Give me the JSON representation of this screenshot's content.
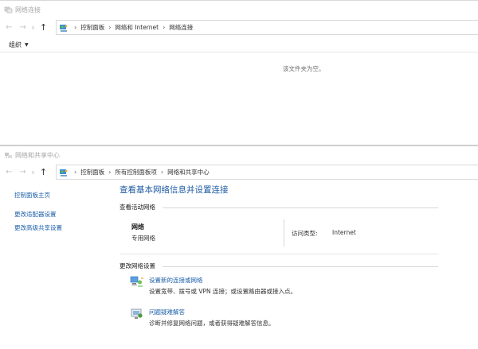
{
  "network_connections": {
    "title": "网络连接",
    "breadcrumb": [
      "控制面板",
      "网络和 Internet",
      "网络连接"
    ],
    "organize_label": "组织",
    "empty_message": "该文件夹为空。"
  },
  "network_center": {
    "title": "网络和共享中心",
    "breadcrumb": [
      "控制面板",
      "所有控制面板项",
      "网络和共享中心"
    ],
    "left_nav": [
      "控制面板主页",
      "更改适配器设置",
      "更改高级共享设置"
    ],
    "heading": "查看基本网络信息并设置连接",
    "active_section": "查看活动网络",
    "network_name": "网络",
    "network_type": "专用网络",
    "access_label": "访问类型:",
    "access_value": "Internet",
    "change_section": "更改网络设置",
    "tasks": [
      {
        "link": "设置新的连接或网络",
        "desc": "设置宽带、拨号或 VPN 连接；或设置路由器或接入点。",
        "icon": "network-setup-icon"
      },
      {
        "link": "问题疑难解答",
        "desc": "诊断并修复网络问题，或者获得疑难解答信息。",
        "icon": "troubleshoot-icon"
      }
    ]
  },
  "icons": {
    "back": "←",
    "forward": "→",
    "recent": "∨",
    "up": "↑",
    "sep": "›",
    "caret": "▼"
  }
}
